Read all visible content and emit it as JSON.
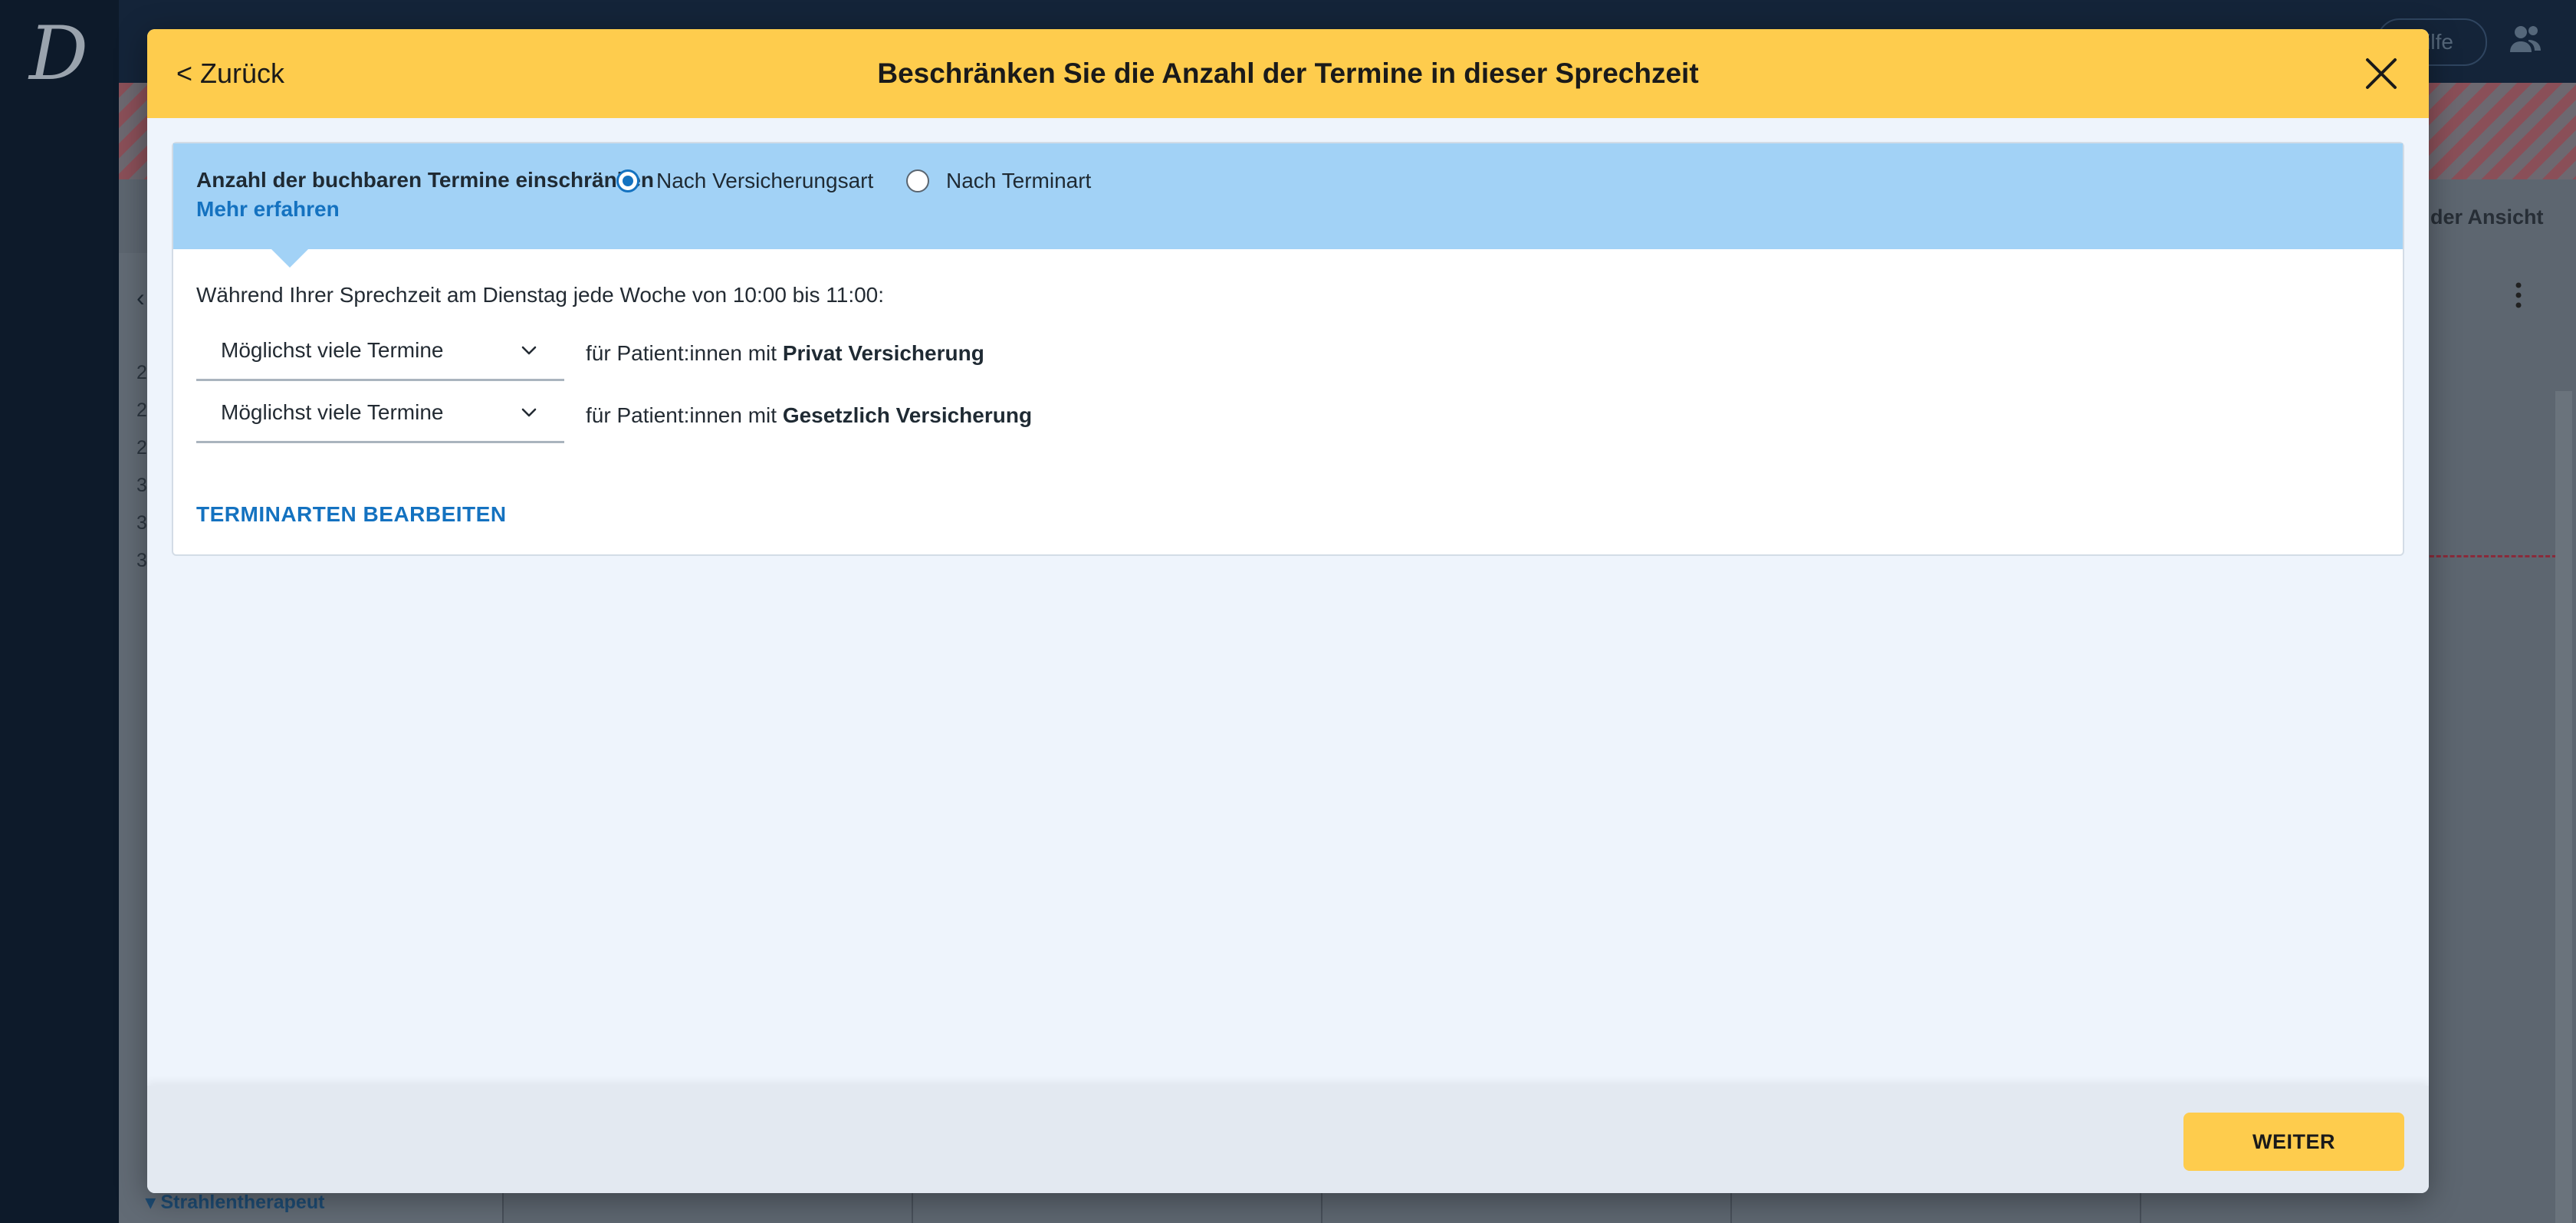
{
  "background_app": {
    "logo": "D",
    "help_label": "Hilfe",
    "view_label": "der Ansicht",
    "row_numbers": [
      "2",
      "2",
      "2",
      "3",
      "3",
      "3"
    ],
    "bottom_label": "▾ Strahlentherapeut"
  },
  "modal": {
    "back_label": "< Zurück",
    "title": "Beschränken Sie die Anzahl der Termine in dieser Sprechzeit",
    "limit": {
      "label": "Anzahl der buchbaren Termine einschränken",
      "options": [
        {
          "label": "Nach Versicherungsart",
          "checked": true
        },
        {
          "label": "Nach Terminart",
          "checked": false
        }
      ],
      "learn_more": "Mehr erfahren"
    },
    "schedule_text": "Während Ihrer Sprechzeit am Dienstag jede Woche von 10:00 bis 11:00:",
    "rows": [
      {
        "select_value": "Möglichst viele Termine",
        "prefix": "für Patient:innen mit",
        "insurance": "Privat Versicherung"
      },
      {
        "select_value": "Möglichst viele Termine",
        "prefix": "für Patient:innen mit",
        "insurance": "Gesetzlich Versicherung"
      }
    ],
    "edit_link": "TERMINARTEN BEARBEITEN",
    "next_label": "WEITER"
  },
  "colors": {
    "accent_yellow": "#fecc4d",
    "info_blue": "#a2d2f6",
    "link_blue": "#1472c0",
    "sidebar_navy": "#0d1a2a"
  }
}
